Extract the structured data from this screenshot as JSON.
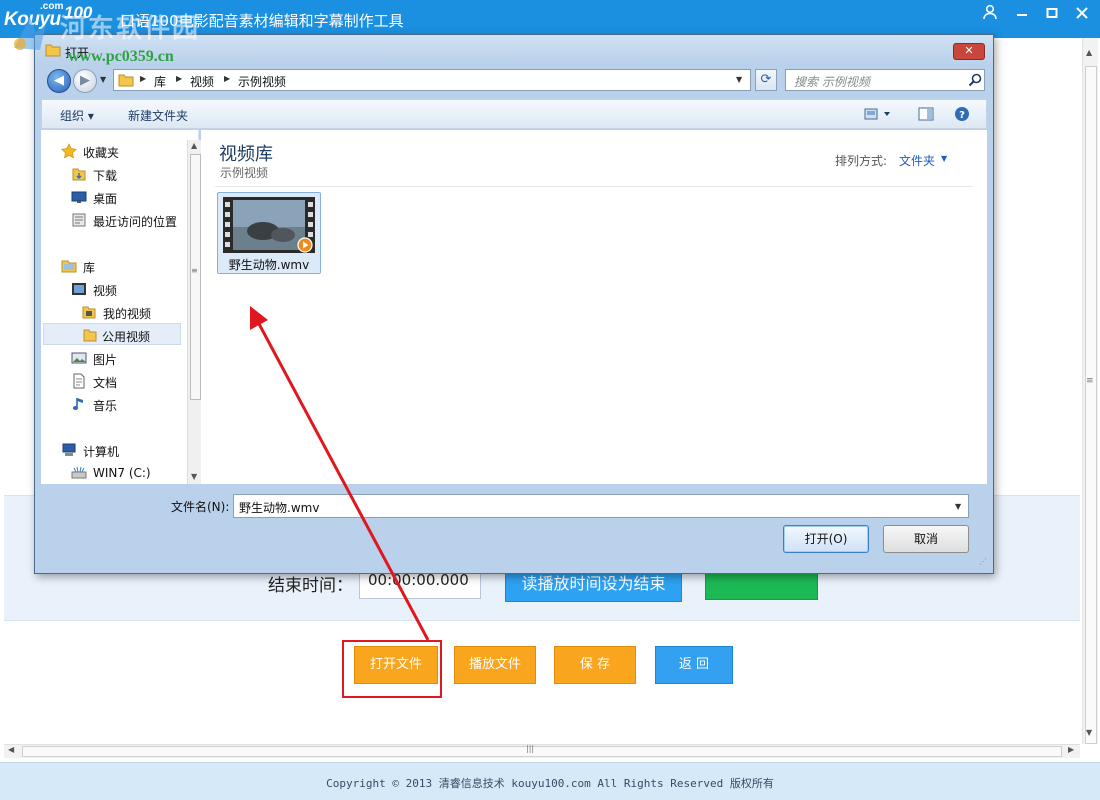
{
  "app": {
    "logo_brand": "Kouyu",
    "logo_dotcom": ".com",
    "logo_num": "100",
    "title": "口语100电影配音素材编辑和字幕制作工具",
    "watermark_url": "www.pc0359.cn",
    "watermark_text": "河东软件园"
  },
  "panel": {
    "end_time_label": "结束时间：",
    "end_time_value": "00:00:00.000",
    "set_end_button": "读播放时间设为结束"
  },
  "bottom_buttons": {
    "open": "打开文件",
    "play": "播放文件",
    "save": "保 存",
    "back": "返 回"
  },
  "footer": {
    "text": "Copyright © 2013 清睿信息技术 kouyu100.com All Rights Reserved 版权所有"
  },
  "dialog": {
    "title": "打开",
    "breadcrumb": [
      "库",
      "视频",
      "示例视频"
    ],
    "search_placeholder": "搜索 示例视频",
    "toolbar": {
      "organize": "组织",
      "new_folder": "新建文件夹"
    },
    "nav": {
      "favorites": "收藏夹",
      "downloads": "下载",
      "desktop": "桌面",
      "recent": "最近访问的位置",
      "libraries": "库",
      "videos": "视频",
      "my_videos": "我的视频",
      "public_videos": "公用视频",
      "pictures": "图片",
      "documents": "文档",
      "music": "音乐",
      "computer": "计算机",
      "drive_c": "WIN7 (C:)"
    },
    "library_title": "视频库",
    "library_subtitle": "示例视频",
    "sort_label": "排列方式:",
    "sort_value": "文件夹",
    "file_name": "野生动物.wmv",
    "filename_label": "文件名(N):",
    "filename_value": "野生动物.wmv",
    "open_button": "打开(O)",
    "cancel_button": "取消"
  },
  "colors": {
    "app_blue": "#1b8fe0",
    "orange_button": "#f9a51d",
    "blue_button": "#33a0f0",
    "green_button": "#1db954",
    "annotation_red": "#e0171e"
  }
}
